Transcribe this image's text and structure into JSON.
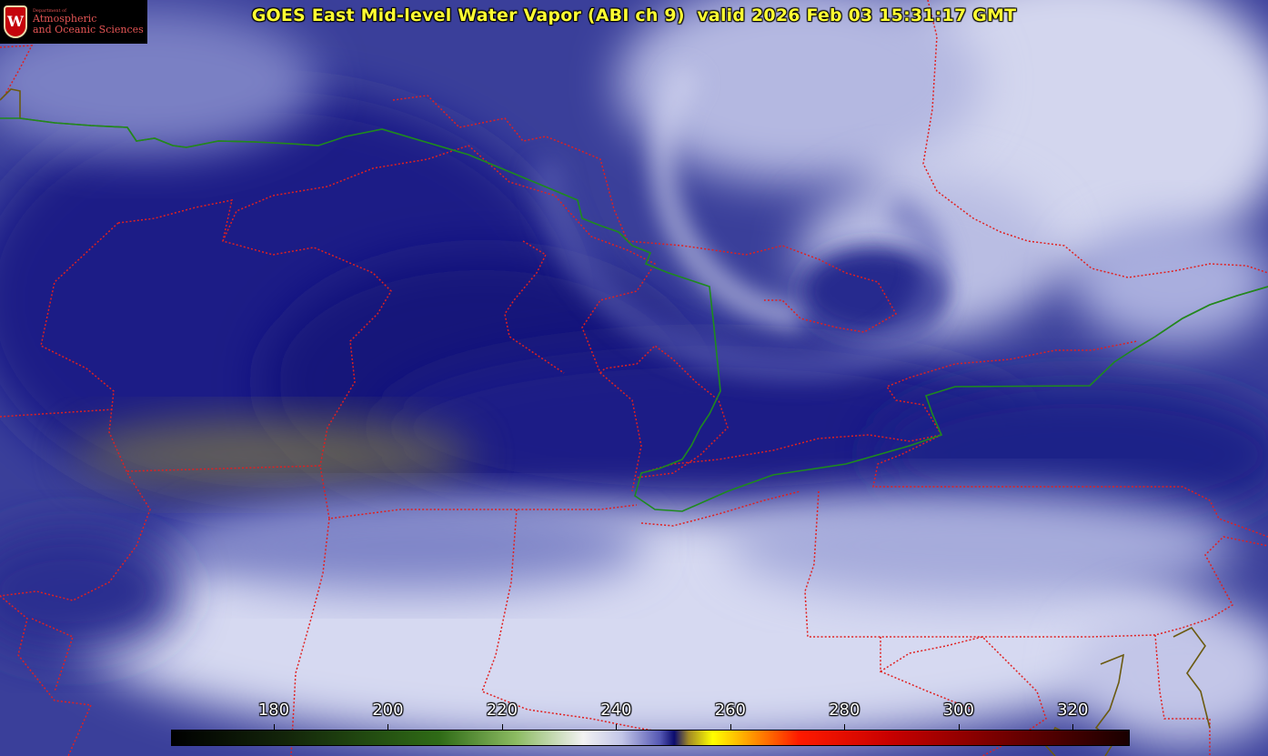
{
  "header": {
    "title": "GOES East Mid-level Water Vapor (ABI ch 9)  valid 2026 Feb 03 15:31:17 GMT"
  },
  "logo": {
    "crest_letter": "W",
    "department_line": "Department of",
    "name_line1": "Atmospheric",
    "name_line2": "and Oceanic Sciences"
  },
  "colorbar": {
    "tick_labels": [
      "180",
      "200",
      "220",
      "240",
      "260",
      "280",
      "300",
      "320"
    ],
    "tick_values": [
      180,
      200,
      220,
      240,
      260,
      280,
      300,
      320
    ],
    "range": [
      162,
      330
    ]
  },
  "colors": {
    "title": "#ffff33",
    "boundary_lines": "#e02020",
    "border_line": "#1e8a1e",
    "coastline": "#6b5a10",
    "moist_blue": "#1c1f86",
    "dry_white": "#e9ebf8"
  }
}
